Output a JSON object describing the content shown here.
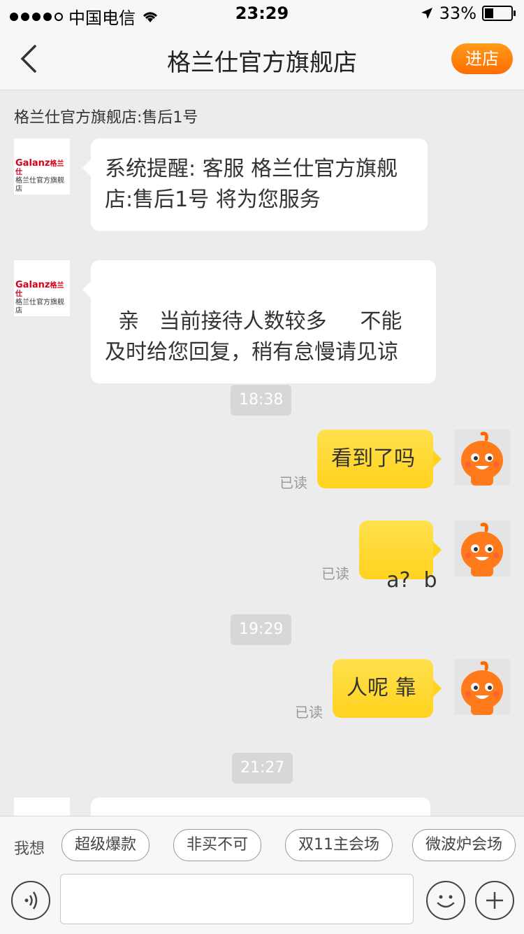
{
  "status_bar": {
    "carrier": "中国电信",
    "time": "23:29",
    "battery": "33%",
    "battery_fraction": 0.33,
    "signal_bars": 4
  },
  "nav": {
    "title": "格兰仕官方旗舰店",
    "enter_button": "进店"
  },
  "shop_subtitle": "格兰仕官方旗舰店:售后1号",
  "shop_logo": {
    "brand": "Galanz",
    "brand_cn": "格兰仕",
    "tagline": "格兰仕官方旗舰店"
  },
  "messages": [
    {
      "type": "in",
      "text": "系统提醒: 客服 格兰仕官方旗舰店:售后1号 将为您服务"
    },
    {
      "type": "in",
      "text": "亲   当前接待人数较多     不能及时给您回复，稍有怠慢请见谅"
    },
    {
      "type": "time",
      "text": "18:38"
    },
    {
      "type": "out",
      "text": "看到了吗",
      "status": "已读"
    },
    {
      "type": "out",
      "text": "a?  b",
      "status": "已读"
    },
    {
      "type": "time",
      "text": "19:29"
    },
    {
      "type": "out",
      "text": "人呢 靠",
      "status": "已读"
    },
    {
      "type": "time",
      "text": "21:27"
    }
  ],
  "quick_bar": {
    "label": "我想",
    "chips": [
      "超级爆款",
      "非买不可",
      "双11主会场",
      "微波炉会场"
    ]
  },
  "input": {
    "value": "",
    "placeholder": ""
  }
}
